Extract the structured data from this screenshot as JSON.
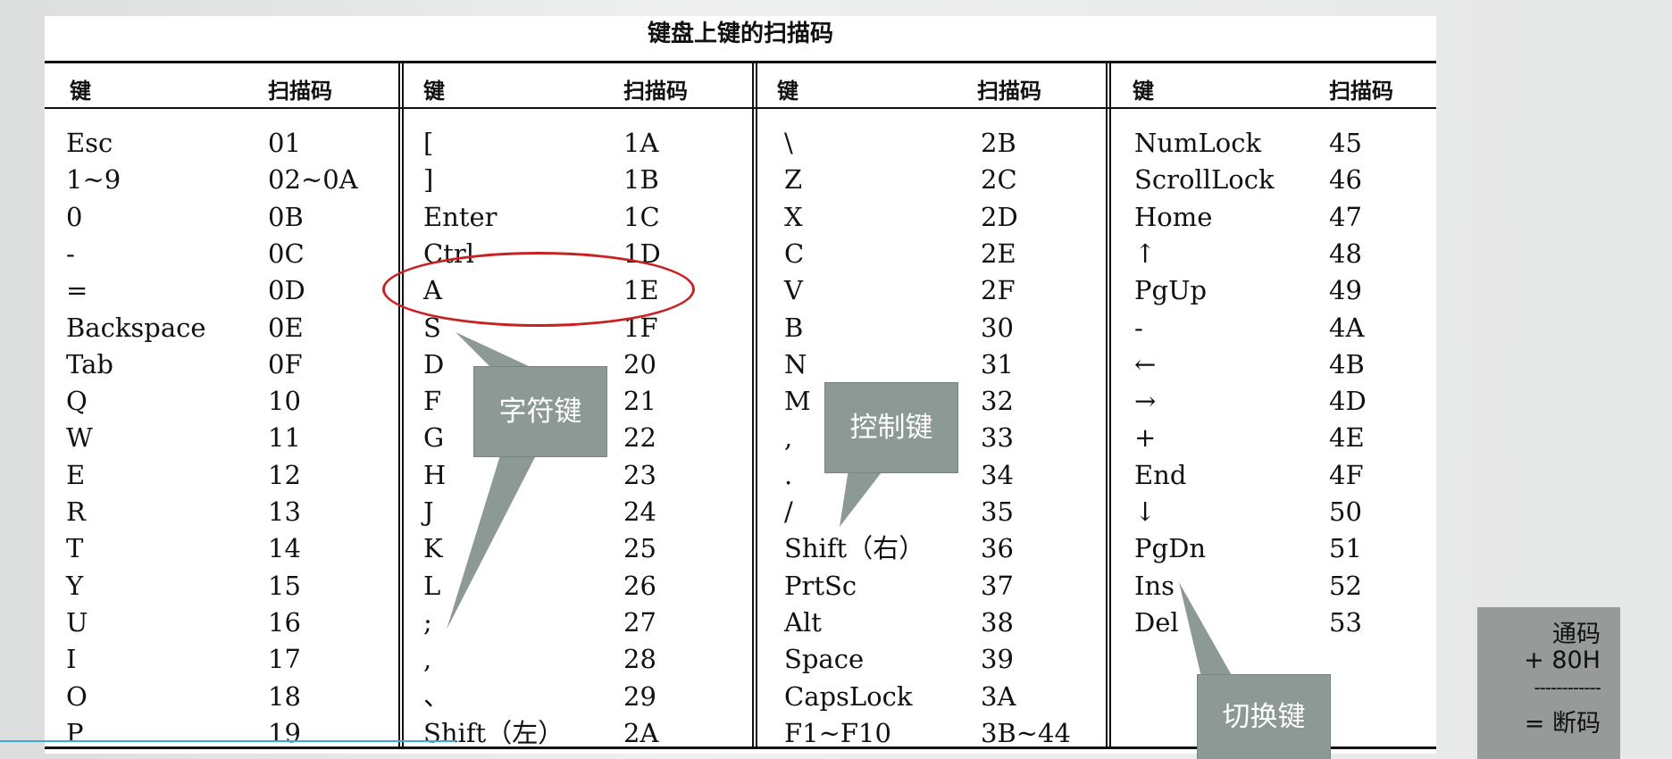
{
  "title": "键盘上键的扫描码",
  "headers": {
    "key": "键",
    "code": "扫描码"
  },
  "columns": [
    {
      "rows": [
        {
          "key": "Esc",
          "code": "01"
        },
        {
          "key": "1~9",
          "code": "02~0A"
        },
        {
          "key": "0",
          "code": "0B"
        },
        {
          "key": "-",
          "code": "0C"
        },
        {
          "key": "=",
          "code": "0D"
        },
        {
          "key": "Backspace",
          "code": "0E"
        },
        {
          "key": "Tab",
          "code": "0F"
        },
        {
          "key": "Q",
          "code": "10"
        },
        {
          "key": "W",
          "code": "11"
        },
        {
          "key": "E",
          "code": "12"
        },
        {
          "key": "R",
          "code": "13"
        },
        {
          "key": "T",
          "code": "14"
        },
        {
          "key": "Y",
          "code": "15"
        },
        {
          "key": "U",
          "code": "16"
        },
        {
          "key": "I",
          "code": "17"
        },
        {
          "key": "O",
          "code": "18"
        },
        {
          "key": "P",
          "code": "19"
        }
      ]
    },
    {
      "rows": [
        {
          "key": "[",
          "code": "1A"
        },
        {
          "key": "]",
          "code": "1B"
        },
        {
          "key": "Enter",
          "code": "1C"
        },
        {
          "key": "Ctrl",
          "code": "1D"
        },
        {
          "key": "A",
          "code": "1E"
        },
        {
          "key": "S",
          "code": "1F"
        },
        {
          "key": "D",
          "code": "20"
        },
        {
          "key": "F",
          "code": "21"
        },
        {
          "key": "G",
          "code": "22"
        },
        {
          "key": "H",
          "code": "23"
        },
        {
          "key": "J",
          "code": "24"
        },
        {
          "key": "K",
          "code": "25"
        },
        {
          "key": "L",
          "code": "26"
        },
        {
          "key": ";",
          "code": "27"
        },
        {
          "key": ",",
          "code": "28"
        },
        {
          "key": "、",
          "code": "29"
        },
        {
          "key": "Shift（左）",
          "code": "2A"
        }
      ]
    },
    {
      "rows": [
        {
          "key": "\\",
          "code": "2B"
        },
        {
          "key": "Z",
          "code": "2C"
        },
        {
          "key": "X",
          "code": "2D"
        },
        {
          "key": "C",
          "code": "2E"
        },
        {
          "key": "V",
          "code": "2F"
        },
        {
          "key": "B",
          "code": "30"
        },
        {
          "key": "N",
          "code": "31"
        },
        {
          "key": "M",
          "code": "32"
        },
        {
          "key": ",",
          "code": "33"
        },
        {
          "key": ".",
          "code": "34"
        },
        {
          "key": "/",
          "code": "35"
        },
        {
          "key": "Shift（右）",
          "code": "36"
        },
        {
          "key": "PrtSc",
          "code": "37"
        },
        {
          "key": "Alt",
          "code": "38"
        },
        {
          "key": "Space",
          "code": "39"
        },
        {
          "key": "CapsLock",
          "code": "3A"
        },
        {
          "key": "F1~F10",
          "code": "3B~44"
        }
      ]
    },
    {
      "rows": [
        {
          "key": "NumLock",
          "code": "45"
        },
        {
          "key": "ScrollLock",
          "code": "46"
        },
        {
          "key": "Home",
          "code": "47"
        },
        {
          "key": "↑",
          "code": "48"
        },
        {
          "key": "PgUp",
          "code": "49"
        },
        {
          "key": "-",
          "code": "4A"
        },
        {
          "key": "←",
          "code": "4B"
        },
        {
          "key": "→",
          "code": "4D"
        },
        {
          "key": "+",
          "code": "4E"
        },
        {
          "key": "End",
          "code": "4F"
        },
        {
          "key": "↓",
          "code": "50"
        },
        {
          "key": "PgDn",
          "code": "51"
        },
        {
          "key": "Ins",
          "code": "52"
        },
        {
          "key": "Del",
          "code": "53"
        }
      ]
    }
  ],
  "callouts": {
    "char_keys": "字符键",
    "control_keys": "控制键",
    "toggle_keys": "切换键"
  },
  "side_note": {
    "line1": "通码",
    "line2": "+ 80H",
    "line3": "------------",
    "line4": "= 断码"
  },
  "colors": {
    "oval": "#c82121",
    "callout_fill": "#8c9994",
    "side_box": "#969a98",
    "progress": "#3fa7e0"
  }
}
